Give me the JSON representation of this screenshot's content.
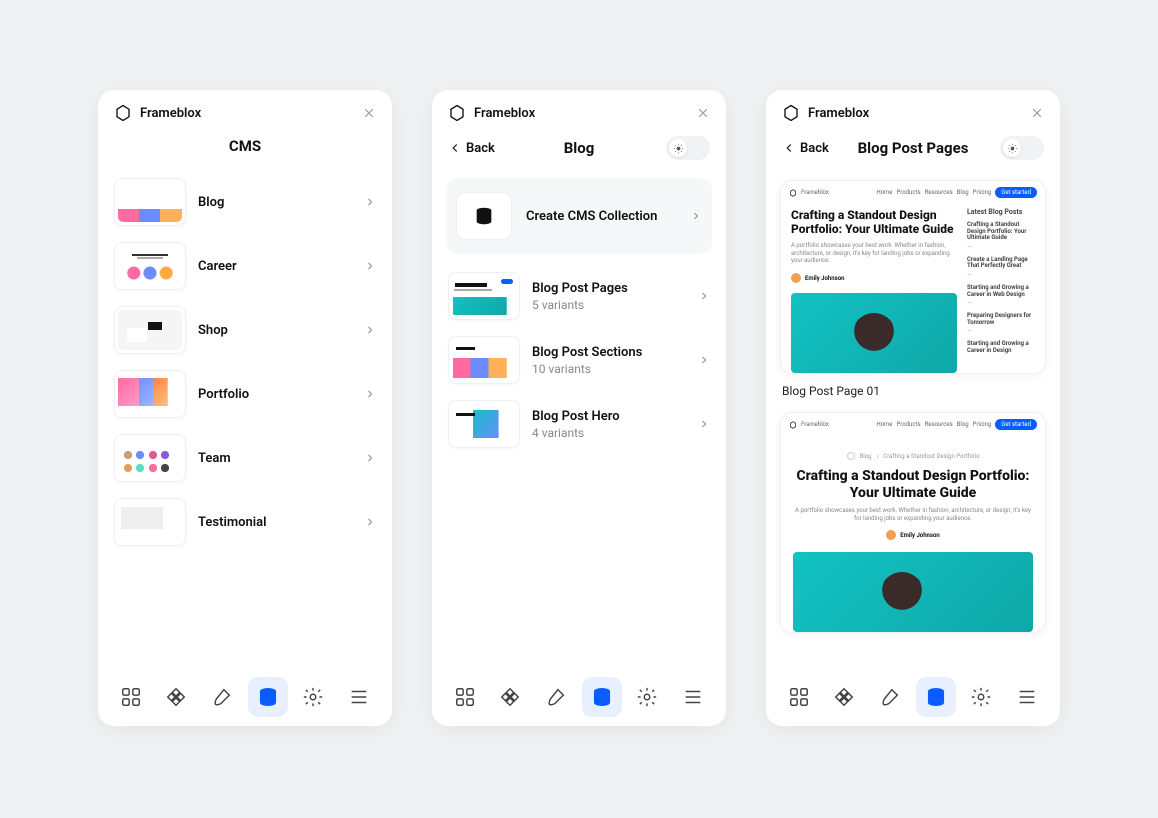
{
  "brand": "Frameblox",
  "panel1": {
    "title": "CMS",
    "items": [
      {
        "label": "Blog"
      },
      {
        "label": "Career"
      },
      {
        "label": "Shop"
      },
      {
        "label": "Portfolio"
      },
      {
        "label": "Team"
      },
      {
        "label": "Testimonial"
      }
    ]
  },
  "panel2": {
    "title": "Blog",
    "back": "Back",
    "feature": "Create CMS Collection",
    "items": [
      {
        "label": "Blog Post Pages",
        "sub": "5 variants"
      },
      {
        "label": "Blog Post Sections",
        "sub": "10 variants"
      },
      {
        "label": "Blog Post Hero",
        "sub": "4 variants"
      }
    ]
  },
  "panel3": {
    "title": "Blog Post Pages",
    "back": "Back",
    "caption1": "Blog Post Page 01",
    "mock": {
      "brand": "Frameblox",
      "nav": [
        "Home",
        "Products",
        "Resources",
        "Blog",
        "Pricing"
      ],
      "cta": "Get started",
      "heading": "Crafting a Standout Design Portfolio: Your Ultimate Guide",
      "para": "A portfolio showcases your best work. Whether in fashion, architecture, or design, it's key for landing jobs or expanding your audience.",
      "author": "Emily Johnson",
      "side_head": "Latest Blog Posts",
      "side_items": [
        "Crafting a Standout Design Portfolio: Your Ultimate Guide",
        "Create a Landing Page That Perfectly Great",
        "Starting and Growing a Career in Web Design",
        "Preparing Designers for Tomorrow",
        "Starting and Growing a Career in Design"
      ],
      "bc_cat": "Blog",
      "bc_title": "Crafting a Standout Design Portfolio"
    }
  }
}
